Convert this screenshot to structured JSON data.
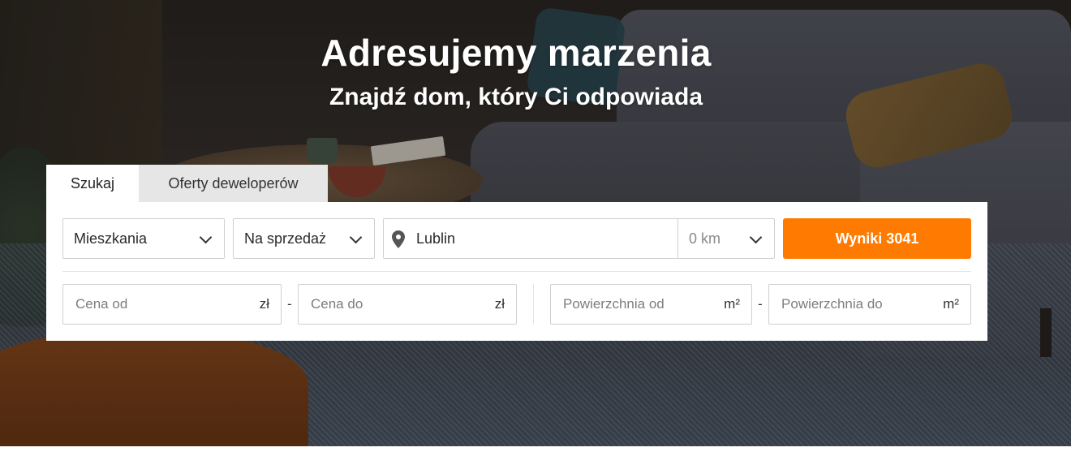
{
  "hero": {
    "title": "Adresujemy marzenia",
    "subtitle": "Znajdź dom, który Ci odpowiada"
  },
  "tabs": [
    {
      "label": "Szukaj",
      "active": true
    },
    {
      "label": "Oferty deweloperów",
      "active": false
    }
  ],
  "search": {
    "property_type": "Mieszkania",
    "transaction_type": "Na sprzedaż",
    "location": "Lublin",
    "radius": "0 km",
    "results_button": "Wyniki 3041",
    "price_from_placeholder": "Cena od",
    "price_to_placeholder": "Cena do",
    "price_unit": "zł",
    "area_from_placeholder": "Powierzchnia od",
    "area_to_placeholder": "Powierzchnia do",
    "area_unit": "m²",
    "separator": "-"
  },
  "colors": {
    "accent": "#ff7a00",
    "tab_inactive_bg": "#e6e6e6",
    "panel_bg": "#ffffff"
  },
  "icons": [
    "location-pin-icon",
    "chevron-down-icon"
  ]
}
